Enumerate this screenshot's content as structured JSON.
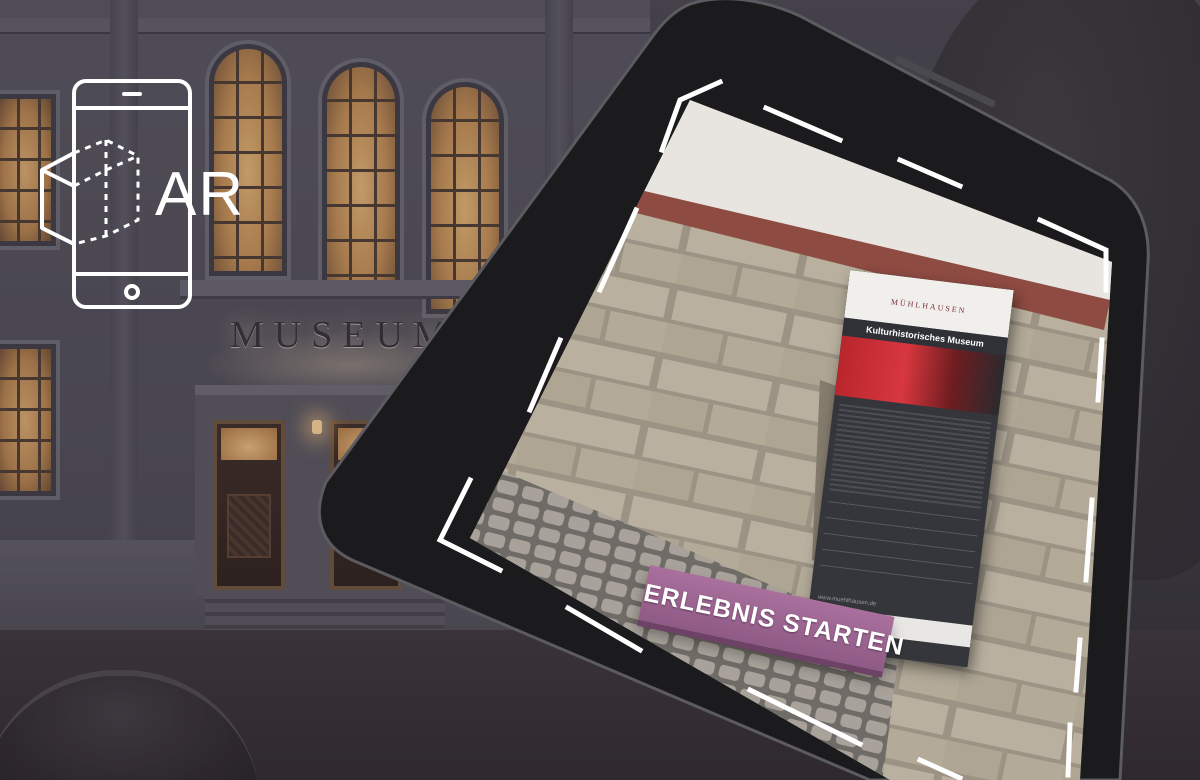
{
  "scene": {
    "building_sign": "MUSEUM",
    "ar_label": "AR",
    "icons": {
      "ar_phone_icon": "smartphone-with-cube-icon"
    }
  },
  "ar_view": {
    "cta_button": "ERLEBNIS STARTEN",
    "stand": {
      "logo": "MÜHLHAUSEN",
      "title": "Kulturhistorisches Museum",
      "url": "www.muehlhausen.de"
    }
  },
  "colors": {
    "cta_button": "#9b6591",
    "overlay_white": "#ffffff",
    "phone_body": "#1b1b1d"
  }
}
